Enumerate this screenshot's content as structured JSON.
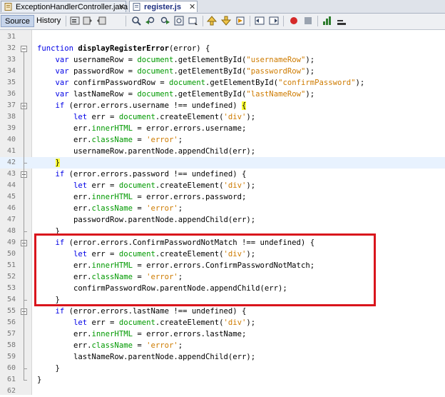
{
  "tabs": [
    {
      "label": "ExceptionHandlerController.java",
      "active": false
    },
    {
      "label": "register.js",
      "active": true
    }
  ],
  "toolbar": {
    "source_label": "Source",
    "history_label": "History",
    "icons": [
      "back-icon",
      "forward-icon",
      "search-icon",
      "find-previous-icon",
      "find-next-icon",
      "find-selection-icon",
      "toggle-highlight-icon",
      "shift-left-icon",
      "shift-right-icon",
      "comment-icon",
      "uncomment-icon",
      "start-macro-icon",
      "stop-macro-icon",
      "chart-icon",
      "line-icon"
    ]
  },
  "colors": {
    "keyword": "#0000e6",
    "string": "#ce7b00",
    "property": "#009900",
    "highlight": "#ffff33",
    "annotation_box": "#d9151c"
  },
  "code_lines": [
    {
      "n": "31",
      "tokens": [
        [
          "",
          ""
        ]
      ]
    },
    {
      "n": "32",
      "tokens": [
        [
          "kw",
          "function "
        ],
        [
          "bold",
          "displayRegisterError"
        ],
        [
          "",
          "(error) {"
        ]
      ]
    },
    {
      "n": "33",
      "tokens": [
        [
          "",
          "    "
        ],
        [
          "kw",
          "var "
        ],
        [
          "",
          "usernameRow = "
        ],
        [
          "prop",
          "document"
        ],
        [
          "",
          ".getElementById("
        ],
        [
          "str",
          "\"usernameRow\""
        ],
        [
          "",
          ");"
        ]
      ]
    },
    {
      "n": "34",
      "tokens": [
        [
          "",
          "    "
        ],
        [
          "kw",
          "var "
        ],
        [
          "",
          "passwordRow = "
        ],
        [
          "prop",
          "document"
        ],
        [
          "",
          ".getElementById("
        ],
        [
          "str",
          "\"passwordRow\""
        ],
        [
          "",
          ");"
        ]
      ]
    },
    {
      "n": "35",
      "tokens": [
        [
          "",
          "    "
        ],
        [
          "kw",
          "var "
        ],
        [
          "",
          "confirmPasswordRow = "
        ],
        [
          "prop",
          "document"
        ],
        [
          "",
          ".getElementById("
        ],
        [
          "str",
          "\"confirmPassword\""
        ],
        [
          "",
          ");"
        ]
      ]
    },
    {
      "n": "36",
      "tokens": [
        [
          "",
          "    "
        ],
        [
          "kw",
          "var "
        ],
        [
          "",
          "lastNameRow = "
        ],
        [
          "prop",
          "document"
        ],
        [
          "",
          ".getElementById("
        ],
        [
          "str",
          "\"lastNameRow\""
        ],
        [
          "",
          ");"
        ]
      ]
    },
    {
      "n": "37",
      "tokens": [
        [
          "",
          "    "
        ],
        [
          "kw",
          "if "
        ],
        [
          "",
          "(error.errors.username !== undefined) "
        ],
        [
          "hl",
          "{"
        ]
      ]
    },
    {
      "n": "38",
      "tokens": [
        [
          "",
          "        "
        ],
        [
          "kw",
          "let "
        ],
        [
          "",
          "err = "
        ],
        [
          "prop",
          "document"
        ],
        [
          "",
          ".createElement("
        ],
        [
          "str",
          "'div'"
        ],
        [
          "",
          ");"
        ]
      ]
    },
    {
      "n": "39",
      "tokens": [
        [
          "",
          "        err."
        ],
        [
          "prop",
          "innerHTML"
        ],
        [
          "",
          " = error.errors.username;"
        ]
      ]
    },
    {
      "n": "40",
      "tokens": [
        [
          "",
          "        err."
        ],
        [
          "prop",
          "className"
        ],
        [
          "",
          " = "
        ],
        [
          "str",
          "'error'"
        ],
        [
          "",
          ";"
        ]
      ]
    },
    {
      "n": "41",
      "tokens": [
        [
          "",
          "        usernameRow.parentNode.appendChild(err);"
        ]
      ]
    },
    {
      "n": "42",
      "tokens": [
        [
          "",
          "    "
        ],
        [
          "hl",
          "}"
        ]
      ]
    },
    {
      "n": "43",
      "tokens": [
        [
          "",
          "    "
        ],
        [
          "kw",
          "if "
        ],
        [
          "",
          "(error.errors.password !== undefined) {"
        ]
      ]
    },
    {
      "n": "44",
      "tokens": [
        [
          "",
          "        "
        ],
        [
          "kw",
          "let "
        ],
        [
          "",
          "err = "
        ],
        [
          "prop",
          "document"
        ],
        [
          "",
          ".createElement("
        ],
        [
          "str",
          "'div'"
        ],
        [
          "",
          ");"
        ]
      ]
    },
    {
      "n": "45",
      "tokens": [
        [
          "",
          "        err."
        ],
        [
          "prop",
          "innerHTML"
        ],
        [
          "",
          " = error.errors.password;"
        ]
      ]
    },
    {
      "n": "46",
      "tokens": [
        [
          "",
          "        err."
        ],
        [
          "prop",
          "className"
        ],
        [
          "",
          " = "
        ],
        [
          "str",
          "'error'"
        ],
        [
          "",
          ";"
        ]
      ]
    },
    {
      "n": "47",
      "tokens": [
        [
          "",
          "        passwordRow.parentNode.appendChild(err);"
        ]
      ]
    },
    {
      "n": "48",
      "tokens": [
        [
          "",
          "    }"
        ]
      ]
    },
    {
      "n": "49",
      "tokens": [
        [
          "",
          "    "
        ],
        [
          "kw",
          "if "
        ],
        [
          "",
          "(error.errors.ConfirmPasswordNotMatch !== undefined) {"
        ]
      ]
    },
    {
      "n": "50",
      "tokens": [
        [
          "",
          "        "
        ],
        [
          "kw",
          "let "
        ],
        [
          "",
          "err = "
        ],
        [
          "prop",
          "document"
        ],
        [
          "",
          ".createElement("
        ],
        [
          "str",
          "'div'"
        ],
        [
          "",
          ");"
        ]
      ]
    },
    {
      "n": "51",
      "tokens": [
        [
          "",
          "        err."
        ],
        [
          "prop",
          "innerHTML"
        ],
        [
          "",
          " = error.errors.ConfirmPasswordNotMatch;"
        ]
      ]
    },
    {
      "n": "52",
      "tokens": [
        [
          "",
          "        err."
        ],
        [
          "prop",
          "className"
        ],
        [
          "",
          " = "
        ],
        [
          "str",
          "'error'"
        ],
        [
          "",
          ";"
        ]
      ]
    },
    {
      "n": "53",
      "tokens": [
        [
          "",
          "        confirmPasswordRow.parentNode.appendChild(err);"
        ]
      ]
    },
    {
      "n": "54",
      "tokens": [
        [
          "",
          "    }"
        ]
      ]
    },
    {
      "n": "55",
      "tokens": [
        [
          "",
          "    "
        ],
        [
          "kw",
          "if "
        ],
        [
          "",
          "(error.errors.lastName !== undefined) {"
        ]
      ]
    },
    {
      "n": "56",
      "tokens": [
        [
          "",
          "        "
        ],
        [
          "kw",
          "let "
        ],
        [
          "",
          "err = "
        ],
        [
          "prop",
          "document"
        ],
        [
          "",
          ".createElement("
        ],
        [
          "str",
          "'div'"
        ],
        [
          "",
          ");"
        ]
      ]
    },
    {
      "n": "57",
      "tokens": [
        [
          "",
          "        err."
        ],
        [
          "prop",
          "innerHTML"
        ],
        [
          "",
          " = error.errors.lastName;"
        ]
      ]
    },
    {
      "n": "58",
      "tokens": [
        [
          "",
          "        err."
        ],
        [
          "prop",
          "className"
        ],
        [
          "",
          " = "
        ],
        [
          "str",
          "'error'"
        ],
        [
          "",
          ";"
        ]
      ]
    },
    {
      "n": "59",
      "tokens": [
        [
          "",
          "        lastNameRow.parentNode.appendChild(err);"
        ]
      ]
    },
    {
      "n": "60",
      "tokens": [
        [
          "",
          "    }"
        ]
      ]
    },
    {
      "n": "61",
      "tokens": [
        [
          "",
          "}"
        ]
      ]
    },
    {
      "n": "62",
      "tokens": [
        [
          "",
          ""
        ]
      ]
    }
  ]
}
